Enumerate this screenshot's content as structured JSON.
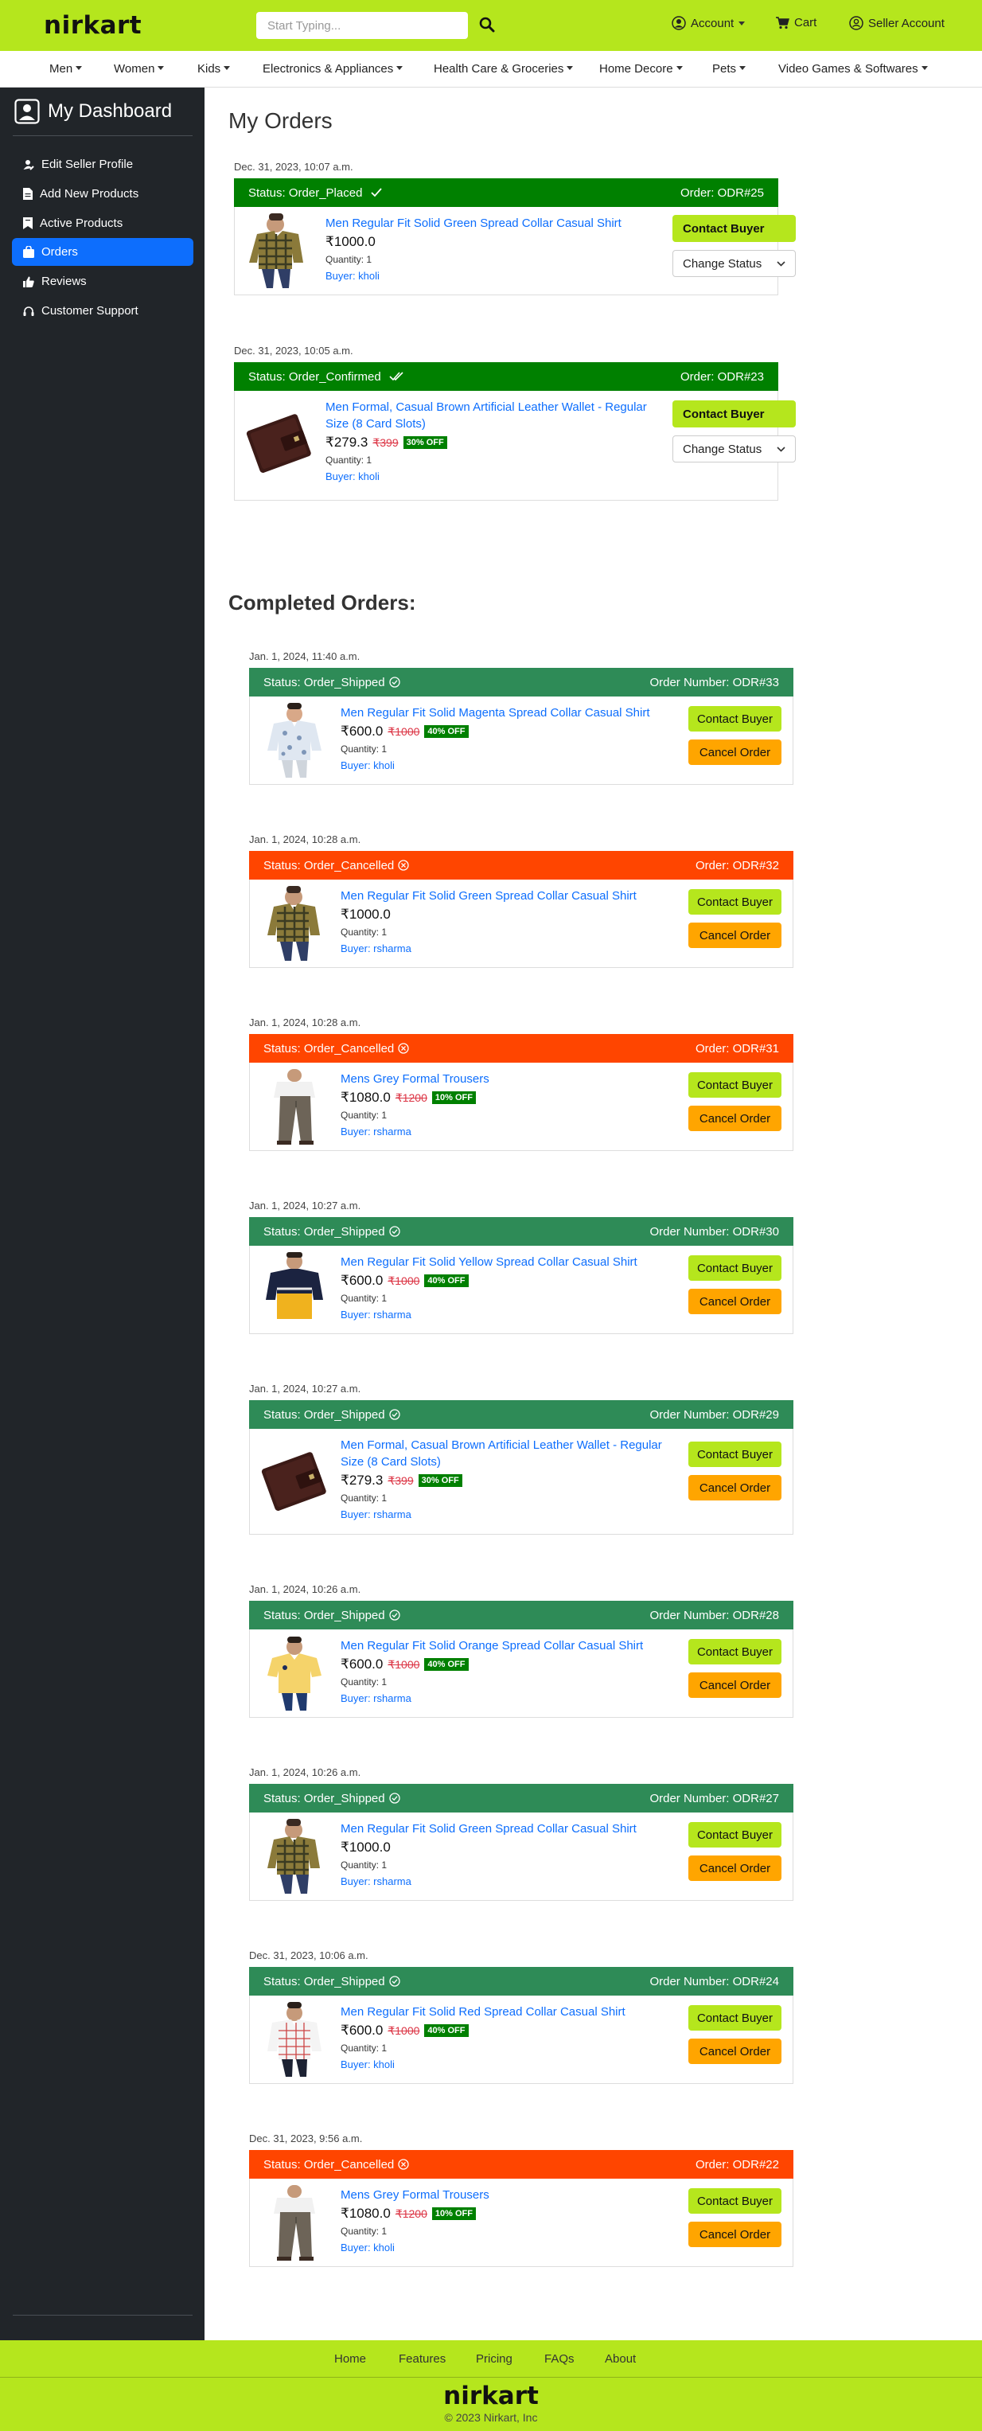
{
  "header": {
    "logo": "nirkart",
    "search_placeholder": "Start Typing...",
    "account": "Account",
    "cart": "Cart",
    "seller_account": "Seller Account"
  },
  "categories": [
    "Men",
    "Women",
    "Kids",
    "Electronics & Appliances",
    "Health Care & Groceries",
    "Home Decore",
    "Pets",
    "Video Games & Softwares"
  ],
  "sidebar": {
    "title": "My Dashboard",
    "items": [
      {
        "label": "Edit Seller Profile",
        "icon": "user-edit-icon"
      },
      {
        "label": "Add New Products",
        "icon": "file-icon"
      },
      {
        "label": "Active Products",
        "icon": "bookmark-icon"
      },
      {
        "label": "Orders",
        "icon": "bag-icon",
        "active": true
      },
      {
        "label": "Reviews",
        "icon": "thumbs-up-icon"
      },
      {
        "label": "Customer Support",
        "icon": "headset-icon"
      }
    ]
  },
  "main": {
    "title": "My Orders",
    "completed_title": "Completed Orders:"
  },
  "buttons": {
    "contact_buyer": "Contact Buyer",
    "cancel_order": "Cancel Order",
    "change_status": "Change Status"
  },
  "active_orders": [
    {
      "date": "Dec. 31, 2023, 10:07 a.m.",
      "status": "Status: Order_Placed",
      "number": "Order: ODR#25",
      "title": "Men Regular Fit Solid Green Spread Collar Casual Shirt",
      "price": "₹1000.0",
      "original": "",
      "discount": "",
      "quantity": "Quantity: 1",
      "buyer": "Buyer: kholi",
      "image": "green-check-shirt"
    },
    {
      "date": "Dec. 31, 2023, 10:05 a.m.",
      "status": "Status: Order_Confirmed",
      "number": "Order: ODR#23",
      "title": "Men Formal, Casual Brown Artificial Leather Wallet - Regular Size (8 Card Slots)",
      "price": "₹279.3",
      "original": "₹399",
      "discount": "30% OFF",
      "quantity": "Quantity: 1",
      "buyer": "Buyer: kholi",
      "image": "wallet"
    }
  ],
  "completed_orders": [
    {
      "date": "Jan. 1, 2024, 11:40 a.m.",
      "status": "Status: Order_Shipped",
      "number": "Order Number: ODR#33",
      "title": "Men Regular Fit Solid Magenta Spread Collar Casual Shirt",
      "price": "₹600.0",
      "original": "₹1000",
      "discount": "40% OFF",
      "quantity": "Quantity: 1",
      "buyer": "Buyer: kholi",
      "kind": "shipped",
      "image": "white-print-shirt"
    },
    {
      "date": "Jan. 1, 2024, 10:28 a.m.",
      "status": "Status: Order_Cancelled",
      "number": "Order: ODR#32",
      "title": "Men Regular Fit Solid Green Spread Collar Casual Shirt",
      "price": "₹1000.0",
      "original": "",
      "discount": "",
      "quantity": "Quantity: 1",
      "buyer": "Buyer: rsharma",
      "kind": "cancelled",
      "image": "green-check-shirt"
    },
    {
      "date": "Jan. 1, 2024, 10:28 a.m.",
      "status": "Status: Order_Cancelled",
      "number": "Order: ODR#31",
      "title": "Mens Grey Formal Trousers",
      "price": "₹1080.0",
      "original": "₹1200",
      "discount": "10% OFF",
      "quantity": "Quantity: 1",
      "buyer": "Buyer: rsharma",
      "kind": "cancelled",
      "image": "trousers"
    },
    {
      "date": "Jan. 1, 2024, 10:27 a.m.",
      "status": "Status: Order_Shipped",
      "number": "Order Number: ODR#30",
      "title": "Men Regular Fit Solid Yellow Spread Collar Casual Shirt",
      "price": "₹600.0",
      "original": "₹1000",
      "discount": "40% OFF",
      "quantity": "Quantity: 1",
      "buyer": "Buyer: rsharma",
      "kind": "shipped",
      "image": "yellow-navy-shirt"
    },
    {
      "date": "Jan. 1, 2024, 10:27 a.m.",
      "status": "Status: Order_Shipped",
      "number": "Order Number: ODR#29",
      "title": "Men Formal, Casual Brown Artificial Leather Wallet - Regular Size (8 Card Slots)",
      "price": "₹279.3",
      "original": "₹399",
      "discount": "30% OFF",
      "quantity": "Quantity: 1",
      "buyer": "Buyer: rsharma",
      "kind": "shipped",
      "image": "wallet"
    },
    {
      "date": "Jan. 1, 2024, 10:26 a.m.",
      "status": "Status: Order_Shipped",
      "number": "Order Number: ODR#28",
      "title": "Men Regular Fit Solid Orange Spread Collar Casual Shirt",
      "price": "₹600.0",
      "original": "₹1000",
      "discount": "40% OFF",
      "quantity": "Quantity: 1",
      "buyer": "Buyer: rsharma",
      "kind": "shipped",
      "image": "yellow-polo"
    },
    {
      "date": "Jan. 1, 2024, 10:26 a.m.",
      "status": "Status: Order_Shipped",
      "number": "Order Number: ODR#27",
      "title": "Men Regular Fit Solid Green Spread Collar Casual Shirt",
      "price": "₹1000.0",
      "original": "",
      "discount": "",
      "quantity": "Quantity: 1",
      "buyer": "Buyer: rsharma",
      "kind": "shipped",
      "image": "green-check-shirt"
    },
    {
      "date": "Dec. 31, 2023, 10:06 a.m.",
      "status": "Status: Order_Shipped",
      "number": "Order Number: ODR#24",
      "title": "Men Regular Fit Solid Red Spread Collar Casual Shirt",
      "price": "₹600.0",
      "original": "₹1000",
      "discount": "40% OFF",
      "quantity": "Quantity: 1",
      "buyer": "Buyer: kholi",
      "kind": "shipped",
      "image": "white-check-shirt"
    },
    {
      "date": "Dec. 31, 2023, 9:56 a.m.",
      "status": "Status: Order_Cancelled",
      "number": "Order: ODR#22",
      "title": "Mens Grey Formal Trousers",
      "price": "₹1080.0",
      "original": "₹1200",
      "discount": "10% OFF",
      "quantity": "Quantity: 1",
      "buyer": "Buyer: kholi",
      "kind": "cancelled",
      "image": "trousers"
    }
  ],
  "footer": {
    "links": [
      "Home",
      "Features",
      "Pricing",
      "FAQs",
      "About"
    ],
    "logo": "nirkart",
    "copyright": "© 2023 Nirkart, Inc"
  },
  "colors": {
    "brand_green": "#b5e61d",
    "placed_green": "#008000",
    "shipped_green": "#2e8b57",
    "cancelled_red": "#ff4500",
    "cancel_orange": "#ffa500",
    "sidebar_dark": "#212529",
    "active_blue": "#0d6efd"
  }
}
